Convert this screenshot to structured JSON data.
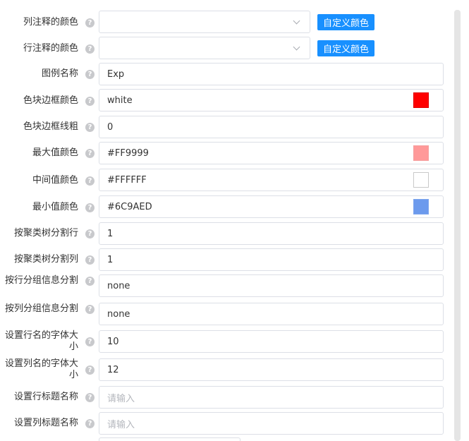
{
  "help_glyph": "?",
  "rows": [
    {
      "label": "列注释的颜色",
      "type": "select",
      "value": "",
      "button": "自定义颜色"
    },
    {
      "label": "行注释的颜色",
      "type": "select",
      "value": "",
      "button": "自定义颜色"
    },
    {
      "label": "图例名称",
      "type": "text",
      "value": "Exp"
    },
    {
      "label": "色块边框颜色",
      "type": "color",
      "value": "white",
      "swatch": "#ff0000"
    },
    {
      "label": "色块边框线粗",
      "type": "text",
      "value": "0"
    },
    {
      "label": "最大值颜色",
      "type": "color",
      "value": "#FF9999",
      "swatch": "#ff9999"
    },
    {
      "label": "中间值颜色",
      "type": "color",
      "value": "#FFFFFF",
      "swatch": "#ffffff"
    },
    {
      "label": "最小值颜色",
      "type": "color",
      "value": "#6C9AED",
      "swatch": "#6c9aed"
    },
    {
      "label": "按聚类树分割行",
      "type": "text",
      "value": "1"
    },
    {
      "label": "按聚类树分割列",
      "type": "text",
      "value": "1"
    },
    {
      "label": "按行分组信息分割",
      "type": "text",
      "value": "none"
    },
    {
      "label": "按列分组信息分割",
      "type": "text",
      "value": "none"
    },
    {
      "label": "设置行名的字体大小",
      "type": "text",
      "value": "10"
    },
    {
      "label": "设置列名的字体大小",
      "type": "text",
      "value": "12"
    },
    {
      "label": "设置行标题名称",
      "type": "text",
      "value": "",
      "placeholder": "请输入"
    },
    {
      "label": "设置列标题名称",
      "type": "text",
      "value": "",
      "placeholder": "请输入"
    }
  ]
}
